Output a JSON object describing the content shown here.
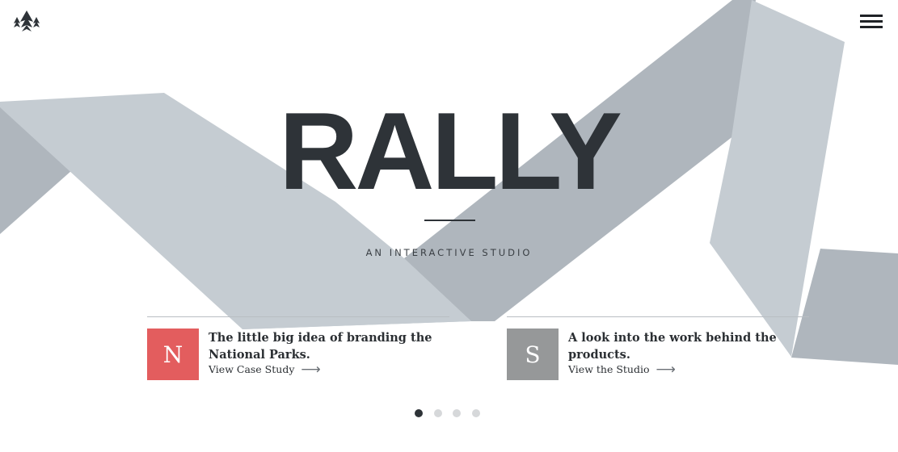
{
  "brand": {
    "title": "RALLY",
    "tagline": "AN INTERACTIVE STUDIO",
    "logo_icon": "triple-pine-tree-icon",
    "menu_icon": "hamburger-menu-icon"
  },
  "colors": {
    "title": "#2e3338",
    "ribbon_light": "#c5ccd2",
    "ribbon_dark": "#afb6bd",
    "background": "#ffffff"
  },
  "cards": [
    {
      "badge": "N",
      "badge_color": "#e35d5e",
      "heading": "The little big idea of branding the National Parks.",
      "link": "View Case Study",
      "arrow_icon": "arrow-right-icon"
    },
    {
      "badge": "S",
      "badge_color": "#969899",
      "heading": "A look into the work behind the products.",
      "link": "View the Studio",
      "arrow_icon": "arrow-right-icon"
    }
  ],
  "carousel": {
    "count": 4,
    "active_index": 0,
    "active_color": "#2e3338",
    "inactive_color": "#d6d8da"
  }
}
